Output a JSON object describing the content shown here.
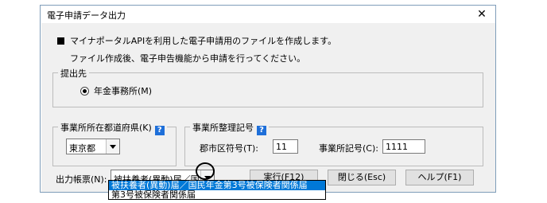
{
  "window": {
    "title": "電子申請データ出力",
    "close_glyph": "✕"
  },
  "info": {
    "line1": "マイナポータルAPIを利用した電子申請用のファイルを作成します。",
    "line2": "ファイル作成後、電子申告機能から申請を行ってください。"
  },
  "submit_to": {
    "legend": "提出先",
    "option_label": "年金事務所(M)"
  },
  "prefecture": {
    "legend": "事業所所在都道府県(K)",
    "value": "東京都"
  },
  "office_code": {
    "legend": "事業所整理記号",
    "district_label": "郡市区符号(T):",
    "district_value": "11",
    "office_label": "事業所記号(C):",
    "office_value": "1111"
  },
  "help_glyph": "?",
  "output_form": {
    "label": "出力帳票(N):",
    "value": "被扶養者(異動)届／国",
    "options": [
      "被扶養者(異動)届／国民年金第3号被保険者関係届",
      "第3号被保険者関係届"
    ]
  },
  "buttons": {
    "run": "実行(F12)",
    "close": "閉じる(Esc)",
    "help": "ヘルプ(F1)"
  },
  "colors": {
    "selection": "#0078d7",
    "help_badge": "#1e6fd9",
    "dialog_bg": "#f0f0f0"
  }
}
